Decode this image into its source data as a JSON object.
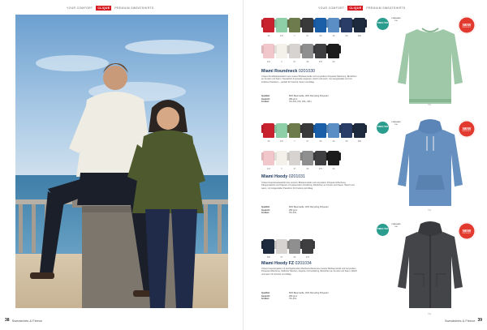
{
  "left_page": {
    "topbar_text": "YOUR COMFORT",
    "topbar_logo": "CLIQUE",
    "topbar_right": "PREMIUM SWEATSHIRTS",
    "folio_number": "38",
    "folio_label": "Sweatshirts & Fleece"
  },
  "right_page": {
    "topbar_text": "YOUR COMFORT",
    "topbar_logo": "CLIQUE",
    "topbar_right": "PREMIUM SWEATSHIRTS",
    "folio_number": "39",
    "folio_label": "Sweatshirts & Fleece"
  },
  "products": [
    {
      "title": "Miami Roundneck",
      "code": "0201030",
      "badge_green": "OEKO TEX",
      "badge_new": "NEW",
      "badge_new_sub": "PRODUCT",
      "standard": "STANDARD 100",
      "desc": "Unisex Rundhalssweatshirt aus unserer Biobaumwolle und recyceltem Polyester-Mischung. Bündchen an Ärmeln und Saum. Sweatshirt-Innenseite angeraut, weich und warm. Gut ausgestattet und mit zeitloser Passform – perfekt für Freizeit, Sport und Alltag.",
      "quality_label": "Qualität:",
      "quality_value": "80% Baumwolle, 20% Recycling Polyester",
      "weight_label": "Gewicht:",
      "weight_value": "280 g/m²",
      "sizes_label": "Größen:",
      "sizes_value": "XS–4XL (XS, XXL–4XL)",
      "caption": "791",
      "swatch_colors_row1": [
        "#c8222e",
        "#8fcfa8",
        "#6e7b4d",
        "#3a3a3a",
        "#1a5fa8",
        "#5b8ec4",
        "#2a3d67",
        "#1e2a3d"
      ],
      "swatch_nums_row1": [
        "35",
        "270",
        "7",
        "67",
        "56",
        "38",
        "58",
        "580"
      ],
      "swatch_colors_row2": [
        "#f2c7cb",
        "#f3f1ea",
        "#d6d3d0",
        "#8f8f8f",
        "#3f3f42",
        "#1c1c1c"
      ],
      "swatch_nums_row2": [
        "213",
        "0",
        "97",
        "95",
        "975",
        "99"
      ]
    },
    {
      "title": "Miami Hoody",
      "code": "0201031",
      "badge_green": "OEKO TEX",
      "badge_new": "NEW",
      "badge_new_sub": "PRODUCT",
      "standard": "STANDARD 100",
      "desc": "Unisex Kapuzensweatshirt aus unserer Biobaumwolle und recyceltem Polyester-Mischung. Kängurutasche und Kapuze mit passendem Kordelzug. Bündchen an Ärmeln und Saum. Weich und warm, mit zeitgemäßer Passform für Freizeit und Alltag.",
      "quality_label": "Qualität:",
      "quality_value": "80% Baumwolle, 20% Recycling Polyester",
      "weight_label": "Gewicht:",
      "weight_value": "280 g/m²",
      "sizes_label": "Größen:",
      "sizes_value": "XS–4XL",
      "caption": "791",
      "swatch_colors_row1": [
        "#c8222e",
        "#8fcfa8",
        "#6e7b4d",
        "#3a3a3a",
        "#1a5fa8",
        "#5b8ec4",
        "#2a3d67",
        "#1e2a3d"
      ],
      "swatch_nums_row1": [
        "35",
        "270",
        "7",
        "67",
        "56",
        "38",
        "58",
        "580"
      ],
      "swatch_colors_row2": [
        "#f2c7cb",
        "#f3f1ea",
        "#d6d3d0",
        "#8f8f8f",
        "#3f3f42",
        "#1c1c1c"
      ],
      "swatch_nums_row2": [
        "213",
        "0",
        "97",
        "95",
        "975",
        "99"
      ]
    },
    {
      "title": "Miami Hoody FZ",
      "code": "0201034",
      "badge_green": "OEKO TEX",
      "badge_new": "NEW",
      "badge_new_sub": "PRODUCT",
      "standard": "STANDARD 100",
      "desc": "Unisex Kapuzenjacke mit durchgehendem Reißverschluss aus unserer Biobaumwolle und recyceltem Polyester-Mischung. Seitliche Taschen, Kapuze mit Kordelzug. Bündchen an Ärmeln und Saum. Weich und warm für Freizeit und Alltag.",
      "quality_label": "Qualität:",
      "quality_value": "80% Baumwolle, 20% Recycling Polyester",
      "weight_label": "Gewicht:",
      "weight_value": "280 g/m²",
      "sizes_label": "Größen:",
      "sizes_value": "XS–4XL",
      "caption": "791",
      "swatch_colors_row1": [
        "#1e2a3d",
        "#d6d3d0",
        "#8f8f8f",
        "#3f3f42"
      ],
      "swatch_nums_row1": [
        "580",
        "97",
        "95",
        "975"
      ]
    }
  ]
}
